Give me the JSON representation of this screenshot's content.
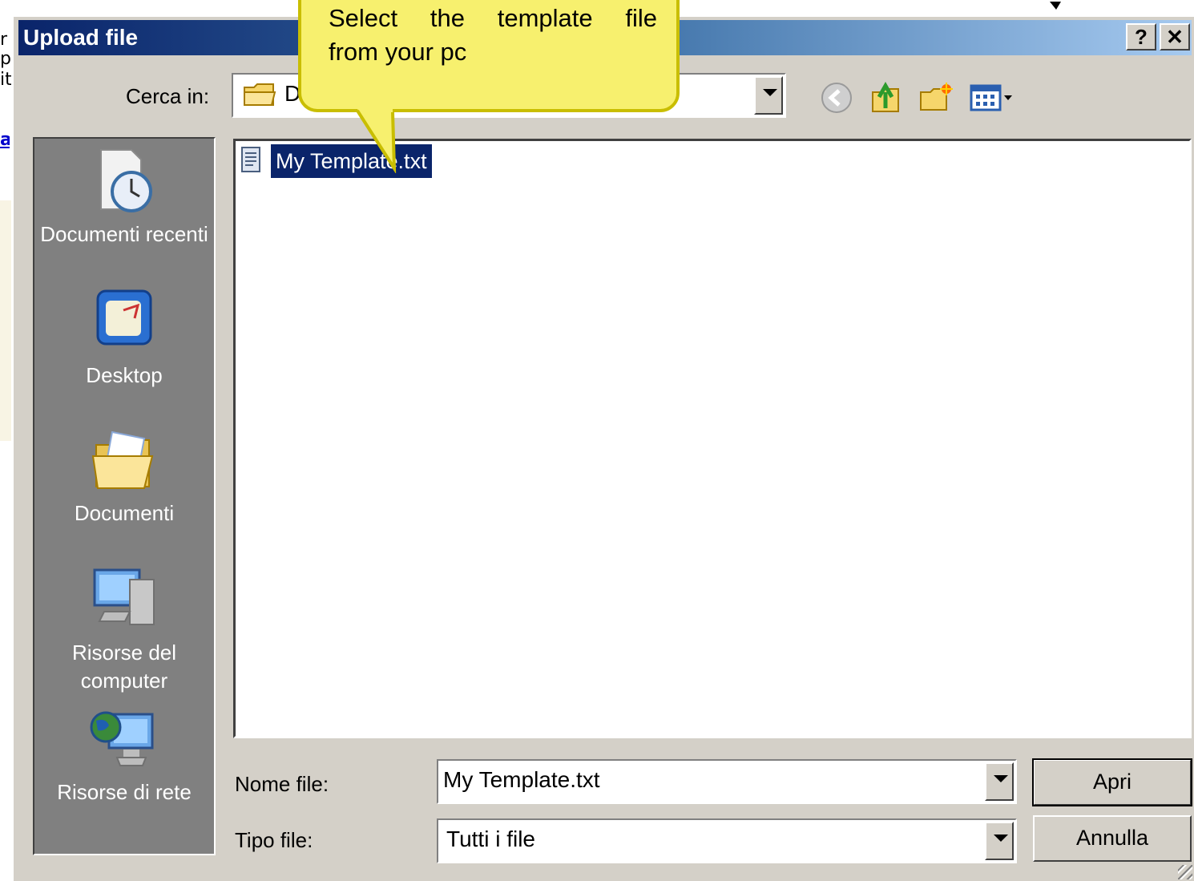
{
  "background": {
    "fragments": [
      "r",
      "pl",
      "it"
    ],
    "link_text": "al"
  },
  "dialog": {
    "title": "Upload file",
    "help_button": "?",
    "close_button": "✕",
    "look_in_label": "Cerca in:",
    "look_in_value": "D",
    "toolbar_icons": [
      "back-icon",
      "up-folder-icon",
      "new-folder-icon",
      "view-menu-icon"
    ],
    "places": [
      {
        "label": "Documenti recenti",
        "icon": "recent-documents-icon"
      },
      {
        "label": "Desktop",
        "icon": "desktop-icon"
      },
      {
        "label": "Documenti",
        "icon": "documents-folder-icon"
      },
      {
        "label": "Risorse del computer",
        "icon": "my-computer-icon"
      },
      {
        "label": "Risorse di rete",
        "icon": "network-icon"
      }
    ],
    "files": [
      {
        "name": "My Template.txt",
        "icon": "text-file-icon",
        "selected": true
      }
    ],
    "filename_label": "Nome file:",
    "filename_value": "My Template.txt",
    "filetype_label": "Tipo file:",
    "filetype_value": "Tutti i file",
    "open_button": "Apri",
    "cancel_button": "Annulla"
  },
  "tooltip": {
    "line1": "Select the template file",
    "line2": "from your pc",
    "color": "#f7f06e"
  },
  "colors": {
    "title_gradient_start": "#0a246a",
    "title_gradient_end": "#a6caf0",
    "selection": "#0a246a",
    "dialog_face": "#d4d0c8",
    "places_bar": "#808080"
  }
}
